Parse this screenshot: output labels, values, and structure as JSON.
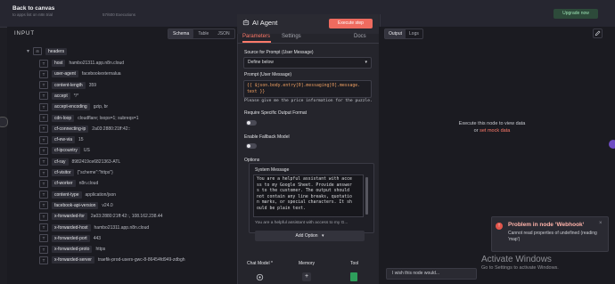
{
  "topbar": {
    "back_label": "Back to canvas",
    "breadcrumb": "to apps list on n8n trial",
    "executions": "57/600 Executions",
    "upgrade_label": "Upgrade now"
  },
  "input_panel": {
    "title": "INPUT",
    "view_tabs": [
      "Schema",
      "Table",
      "JSON"
    ],
    "active_view": "Schema",
    "root_key": "headers",
    "rows": [
      {
        "key": "host",
        "value": "hambo21311.app.n8n.cloud"
      },
      {
        "key": "user-agent",
        "value": "facebookexternalua"
      },
      {
        "key": "content-length",
        "value": "359"
      },
      {
        "key": "accept",
        "value": "*/*"
      },
      {
        "key": "accept-encoding",
        "value": "gzip, br"
      },
      {
        "key": "cdn-loop",
        "value": "cloudflare; loops=1; subreqs=1"
      },
      {
        "key": "cf-connecting-ip",
        "value": "2a03:2880:21ff:42::"
      },
      {
        "key": "cf-ew-via",
        "value": "15"
      },
      {
        "key": "cf-ipcountry",
        "value": "US"
      },
      {
        "key": "cf-ray",
        "value": "8982419ce6821363-ATL"
      },
      {
        "key": "cf-visitor",
        "value": "{\"scheme\":\"https\"}"
      },
      {
        "key": "cf-worker",
        "value": "n8n.cloud"
      },
      {
        "key": "content-type",
        "value": "application/json"
      },
      {
        "key": "facebook-api-version",
        "value": "v24.0"
      },
      {
        "key": "x-forwarded-for",
        "value": "2a03:2880:21ff:42::, 108.162.238.44"
      },
      {
        "key": "x-forwarded-host",
        "value": "hambo21311.app.n8n.cloud"
      },
      {
        "key": "x-forwarded-port",
        "value": "443"
      },
      {
        "key": "x-forwarded-proto",
        "value": "https"
      },
      {
        "key": "x-forwarded-server",
        "value": "traefik-prod-users-gwc-8-86454fd949-zdbgh"
      }
    ]
  },
  "modal": {
    "title": "AI Agent",
    "execute_label": "Execute step",
    "tab_parameters": "Parameters",
    "tab_settings": "Settings",
    "docs_label": "Docs",
    "source_label": "Source for Prompt (User Message)",
    "source_value": "Define below",
    "prompt_label": "Prompt (User Message)",
    "prompt_line1": "{{ $json.body.entry[0].messaging[0].message.",
    "prompt_line2": "text }}",
    "prompt_preview": "Please give me the price information for the puzzle.",
    "require_output_label": "Require Specific Output Format",
    "fallback_label": "Enable Fallback Model",
    "options_label": "Options",
    "system_message_label": "System Message",
    "system_lines": [
      "You are a helpful assistant with acce",
      "ss to my Google Sheet. Provide answer",
      "s to the customer. The output should",
      "not contain any line breaks, quotatio",
      "n marks, or special characters. It sh",
      "ould be plain text."
    ],
    "system_preview": "You are a helpful assistant with access to my G...",
    "add_option_label": "Add Option",
    "bottom": {
      "chat_model": "Chat Model *",
      "memory": "Memory",
      "tool": "Tool"
    }
  },
  "output_panel": {
    "tabs": [
      "Output",
      "Logs"
    ],
    "active_tab": "Output",
    "exec_msg": "Execute this node to view data",
    "or_label": "or",
    "mock_link": "set mock data"
  },
  "toast": {
    "title": "Problem in node ‘Webhook‘",
    "message": "Cannot read properties of undefined (reading 'map')"
  },
  "feedback": {
    "wish_label": "I wish this node would..."
  },
  "windows": {
    "line1": "Activate Windows",
    "line2": "Go to Settings to activate Windows."
  },
  "colors": {
    "accent": "#ff7a6a",
    "execute_button": "#ef6b5f",
    "error": "#e2554b"
  }
}
